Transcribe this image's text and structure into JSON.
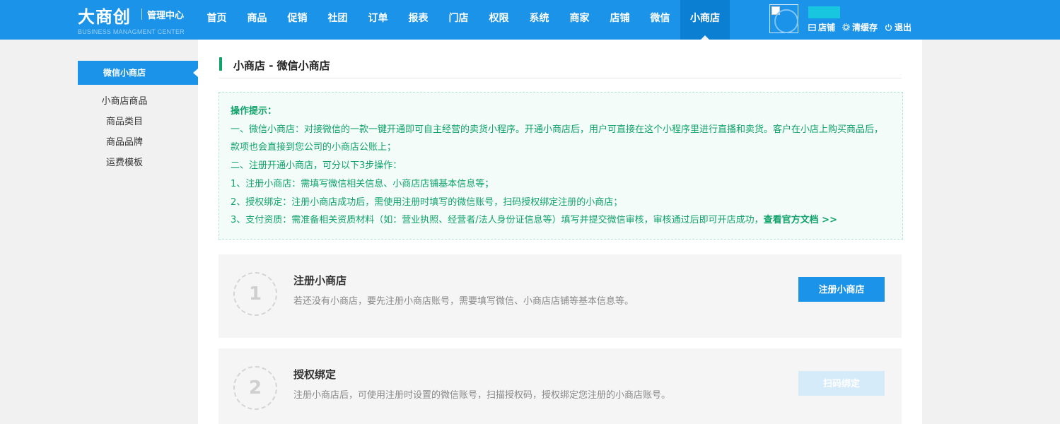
{
  "header": {
    "logo_main": "大商创",
    "logo_sub": "管理中心",
    "logo_en": "BUSINESS MANAGMENT CENTER",
    "nav": [
      {
        "label": "首页",
        "active": false
      },
      {
        "label": "商品",
        "active": false
      },
      {
        "label": "促销",
        "active": false
      },
      {
        "label": "社团",
        "active": false
      },
      {
        "label": "订单",
        "active": false
      },
      {
        "label": "报表",
        "active": false
      },
      {
        "label": "门店",
        "active": false
      },
      {
        "label": "权限",
        "active": false
      },
      {
        "label": "系统",
        "active": false
      },
      {
        "label": "商家",
        "active": false
      },
      {
        "label": "店铺",
        "active": false
      },
      {
        "label": "微信",
        "active": false
      },
      {
        "label": "小商店",
        "active": true
      }
    ],
    "actions": {
      "store": "店铺",
      "clear_cache": "清缓存",
      "logout": "退出"
    }
  },
  "sidebar": {
    "active": "微信小商店",
    "items": [
      "小商店商品",
      "商品类目",
      "商品品牌",
      "运费模板"
    ]
  },
  "main": {
    "title": "小商店 - 微信小商店",
    "tips": {
      "title": "操作提示：",
      "lines": [
        "一、微信小商店：对接微信的一款一键开通即可自主经营的卖货小程序。开通小商店后，用户可直接在这个小程序里进行直播和卖货。客户在小店上购买商品后，款项也会直接到您公司的小商店公账上；",
        "二、注册开通小商店，可分以下3步操作：",
        "1、注册小商店：需填写微信相关信息、小商店店铺基本信息等；",
        "2、授权绑定：注册小商店成功后，需使用注册时填写的微信账号，扫码授权绑定注册的小商店；",
        "3、支付资质：需准备相关资质材料（如：营业执照、经营者/法人身份证信息等）填写并提交微信审核，审核通过后即可开店成功，"
      ],
      "link": "查看官方文档 >>"
    },
    "steps": [
      {
        "num": "1",
        "title": "注册小商店",
        "desc": "若还没有小商店，要先注册小商店账号，需要填写微信、小商店店铺等基本信息等。",
        "button": "注册小商店",
        "enabled": true
      },
      {
        "num": "2",
        "title": "授权绑定",
        "desc": "注册小商店后，可使用注册时设置的微信账号，扫描授权码，授权绑定您注册的小商店账号。",
        "button": "扫码绑定",
        "enabled": false
      }
    ]
  },
  "colors": {
    "primary": "#1a93e9",
    "active_nav": "#0b7fd1",
    "tips_green": "#11a26a",
    "tips_bg": "#f3fcf9"
  }
}
